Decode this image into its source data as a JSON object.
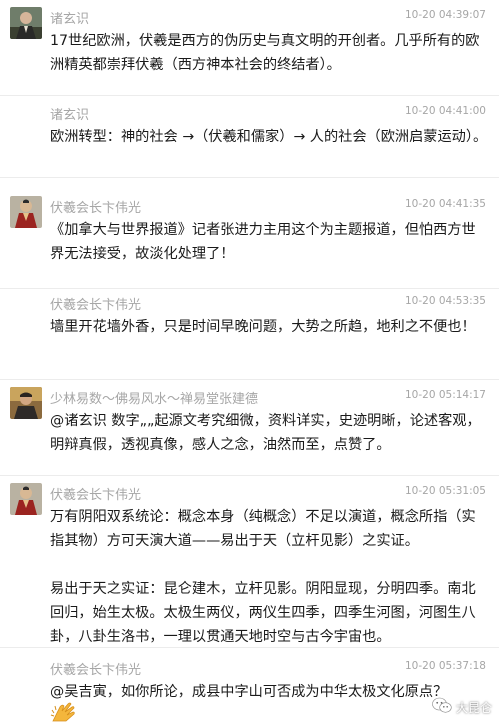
{
  "comments": [
    {
      "avatar": "avatar-dark-kimono",
      "name": "诸玄识",
      "time": "10-20 04:39:07",
      "text": "17世纪欧洲，伏羲是西方的伪历史与真文明的开创者。几乎所有的欧洲精英都崇拜伏羲（西方神本社会的终结者）。"
    },
    {
      "avatar": "none",
      "name": "诸玄识",
      "time": "10-20 04:41:00",
      "text": "欧洲转型：神的社会 →（伏羲和儒家）→ 人的社会（欧洲启蒙运动）。"
    },
    {
      "avatar": "avatar-man-red-robe",
      "name": "伏羲会长卞伟光",
      "time": "10-20 04:41:35",
      "text": "《加拿大与世界报道》记者张进力主用这个为主题报道，但怕西方世界无法接受，故淡化处理了！"
    },
    {
      "avatar": "none",
      "name": "伏羲会长卞伟光",
      "time": "10-20 04:53:35",
      "text": "墙里开花墙外香，只是时间早晚问题，大势之所趋，地利之不便也！"
    },
    {
      "avatar": "avatar-man-dark-shirt",
      "name": "少林易数～佛易风水～禅易堂张建德",
      "time": "10-20 05:14:17",
      "text": "@诸玄识 数字„„起源文考究细微，资料详实，史迹明晰，论述客观，明辩真假，透视真像，感人之念，油然而至，点赞了。"
    },
    {
      "avatar": "avatar-man-red-robe",
      "name": "伏羲会长卞伟光",
      "time": "10-20 05:31:05",
      "text": "万有阴阳双系统论：概念本身（纯概念）不足以演道，概念所指（实指其物）方可天演大道——易出于天（立杆见影）之实证。\n\n易出于天之实证：昆仑建木，立杆见影。阴阳显现，分明四季。南北回归，始生太极。太极生两仪，两仪生四季，四季生河图，河图生八卦，八卦生洛书，一理以贯通天地时空与古今宇宙也。"
    },
    {
      "avatar": "none",
      "name": "伏羲会长卞伟光",
      "time": "10-20 05:37:18",
      "text": "@吴吉寅，如你所论，成县中字山可否成为中华太极文化原点？"
    }
  ],
  "emoji": "clapping-hands-emoji",
  "watermark": {
    "icon": "wechat-icon",
    "text": "大昆仑"
  }
}
